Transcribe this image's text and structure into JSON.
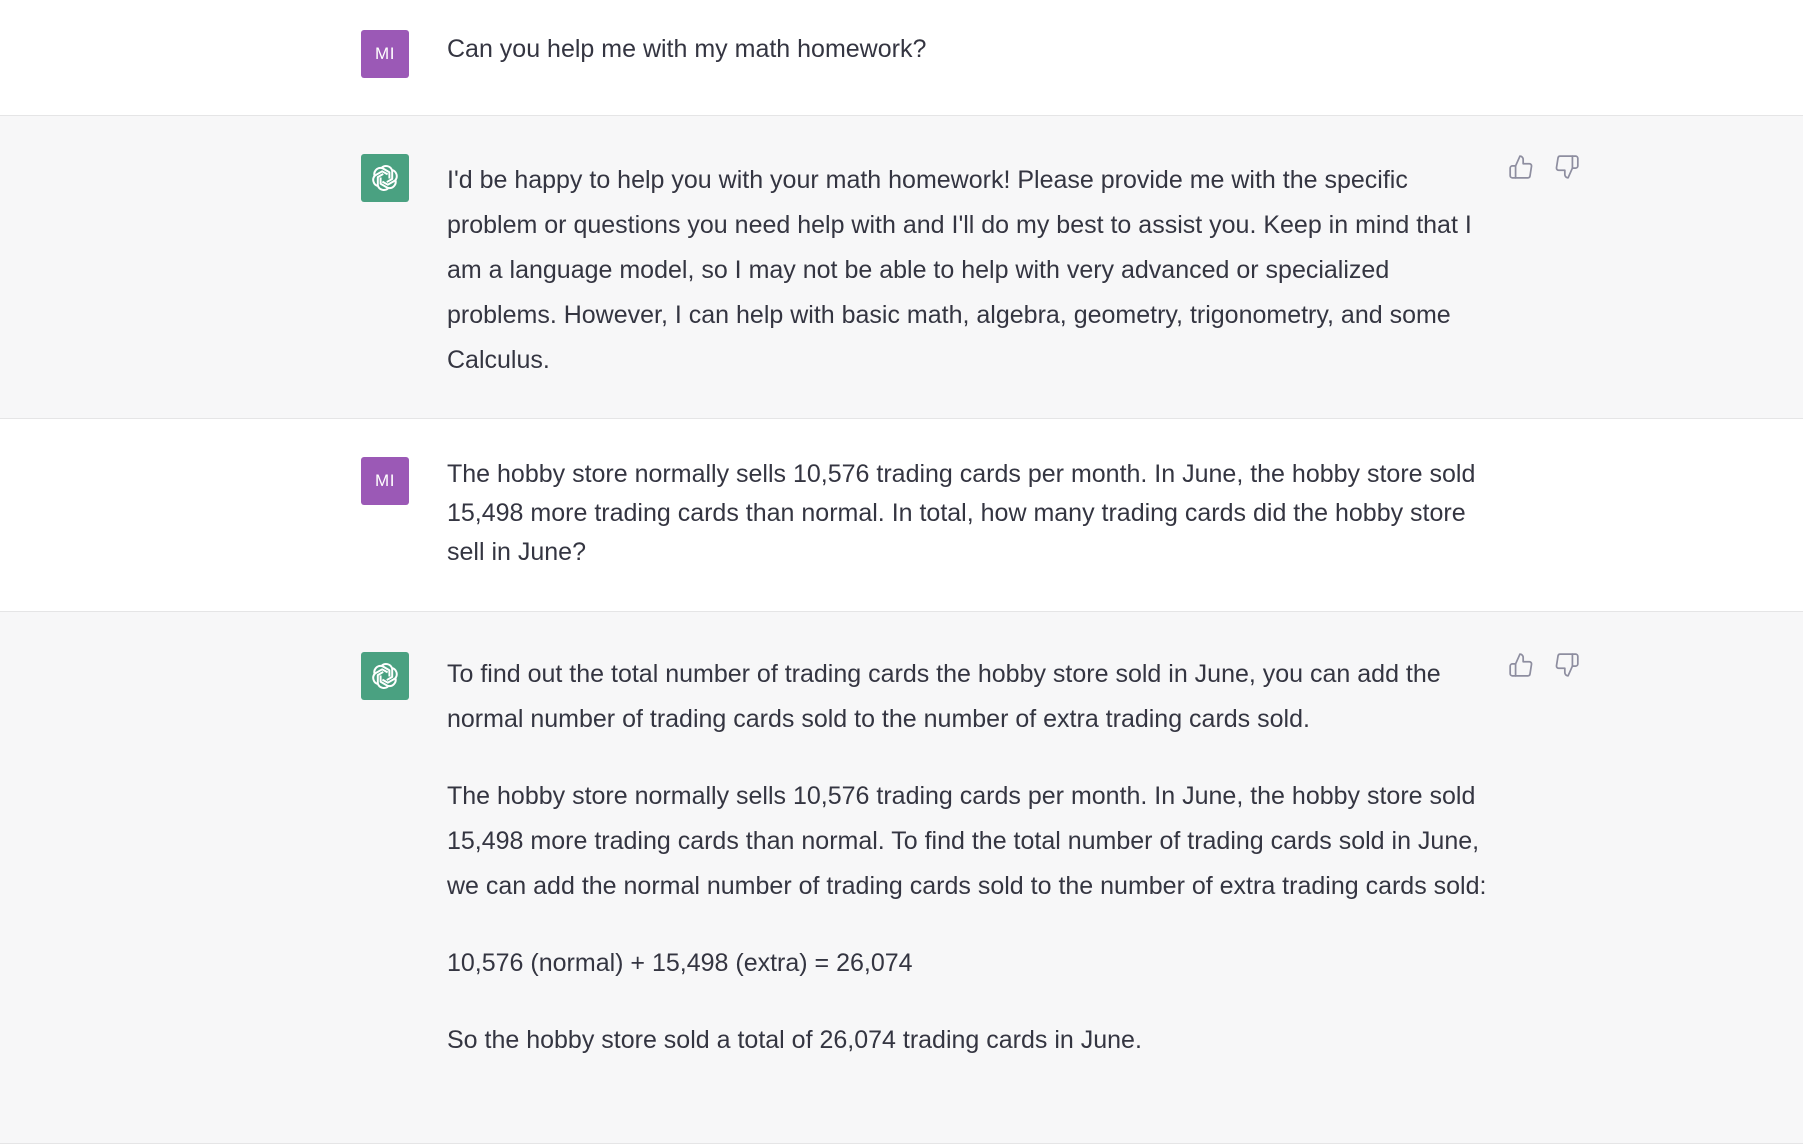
{
  "messages": [
    {
      "role": "user",
      "avatar_label": "MI",
      "paragraphs": [
        "Can you help me with my math homework?"
      ]
    },
    {
      "role": "assistant",
      "avatar_icon": "openai-logo-icon",
      "paragraphs": [
        "I'd be happy to help you with your math homework! Please provide me with the specific problem or questions you need help with and I'll do my best to assist you. Keep in mind that I am a language model, so I may not be able to help with very advanced or specialized problems. However, I can help with basic math, algebra, geometry, trigonometry, and some Calculus."
      ]
    },
    {
      "role": "user",
      "avatar_label": "MI",
      "paragraphs": [
        "The hobby store normally sells 10,576 trading cards per month. In June, the hobby store sold 15,498 more trading cards than normal. In total, how many trading cards did the hobby store sell in June?"
      ]
    },
    {
      "role": "assistant",
      "avatar_icon": "openai-logo-icon",
      "paragraphs": [
        "To find out the total number of trading cards the hobby store sold in June, you can add the normal number of trading cards sold to the number of extra trading cards sold.",
        "The hobby store normally sells 10,576 trading cards per month. In June, the hobby store sold 15,498 more trading cards than normal. To find the total number of trading cards sold in June, we can add the normal number of trading cards sold to the number of extra trading cards sold:",
        "10,576 (normal) + 15,498 (extra) = 26,074",
        "So the hobby store sold a total of 26,074 trading cards in June."
      ]
    }
  ],
  "feedback": {
    "thumbs_up_icon": "thumbs-up-icon",
    "thumbs_down_icon": "thumbs-down-icon"
  },
  "colors": {
    "user_avatar_bg": "#9b59b6",
    "assistant_avatar_bg": "#4aa181",
    "assistant_row_bg": "#f7f7f8",
    "text": "#343541"
  }
}
